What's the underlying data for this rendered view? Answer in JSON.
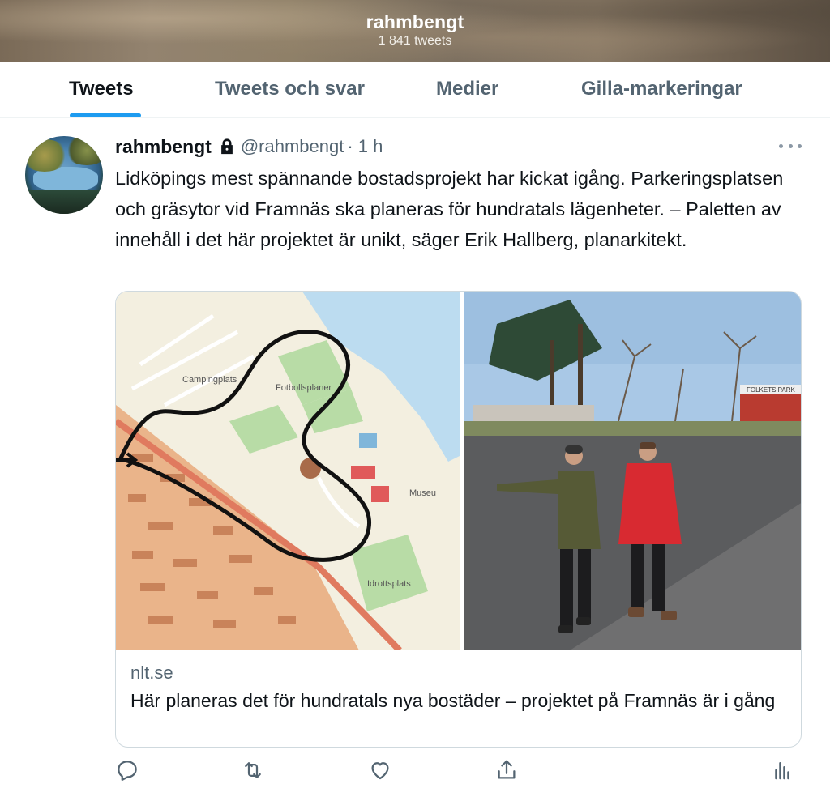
{
  "header": {
    "title": "rahmbengt",
    "tweet_count": "1 841 tweets"
  },
  "tabs": [
    {
      "label": "Tweets",
      "active": true
    },
    {
      "label": "Tweets och svar",
      "active": false
    },
    {
      "label": "Medier",
      "active": false
    },
    {
      "label": "Gilla-markeringar",
      "active": false
    }
  ],
  "tweet": {
    "author": "rahmbengt",
    "protected_icon": "lock-icon",
    "handle": "@rahmbengt",
    "time": "· 1 h",
    "text": "Lidköpings mest spännande bostadsprojekt har kickat igång. Parkeringsplatsen och gräsytor vid Framnäs ska planeras för hundratals lägenheter. – Paletten av innehåll i det här projektet är unikt, säger Erik Hallberg, planarkitekt.",
    "card": {
      "domain": "nlt.se",
      "title": "Här planeras det för hundratals nya bostäder – projektet på Framnäs är i gång",
      "map_labels": {
        "camping": "Campingplats",
        "football": "Fotbollsplaner",
        "museum": "Museu",
        "sports": "Idrottsplats"
      },
      "sign_text": "FOLKETS PARK"
    },
    "actions": [
      "reply-icon",
      "retweet-icon",
      "like-icon",
      "share-icon",
      "analytics-icon"
    ]
  },
  "colors": {
    "accent": "#1d9bf0",
    "text_primary": "#0f1419",
    "text_secondary": "#536471",
    "border": "#cfd9de"
  }
}
